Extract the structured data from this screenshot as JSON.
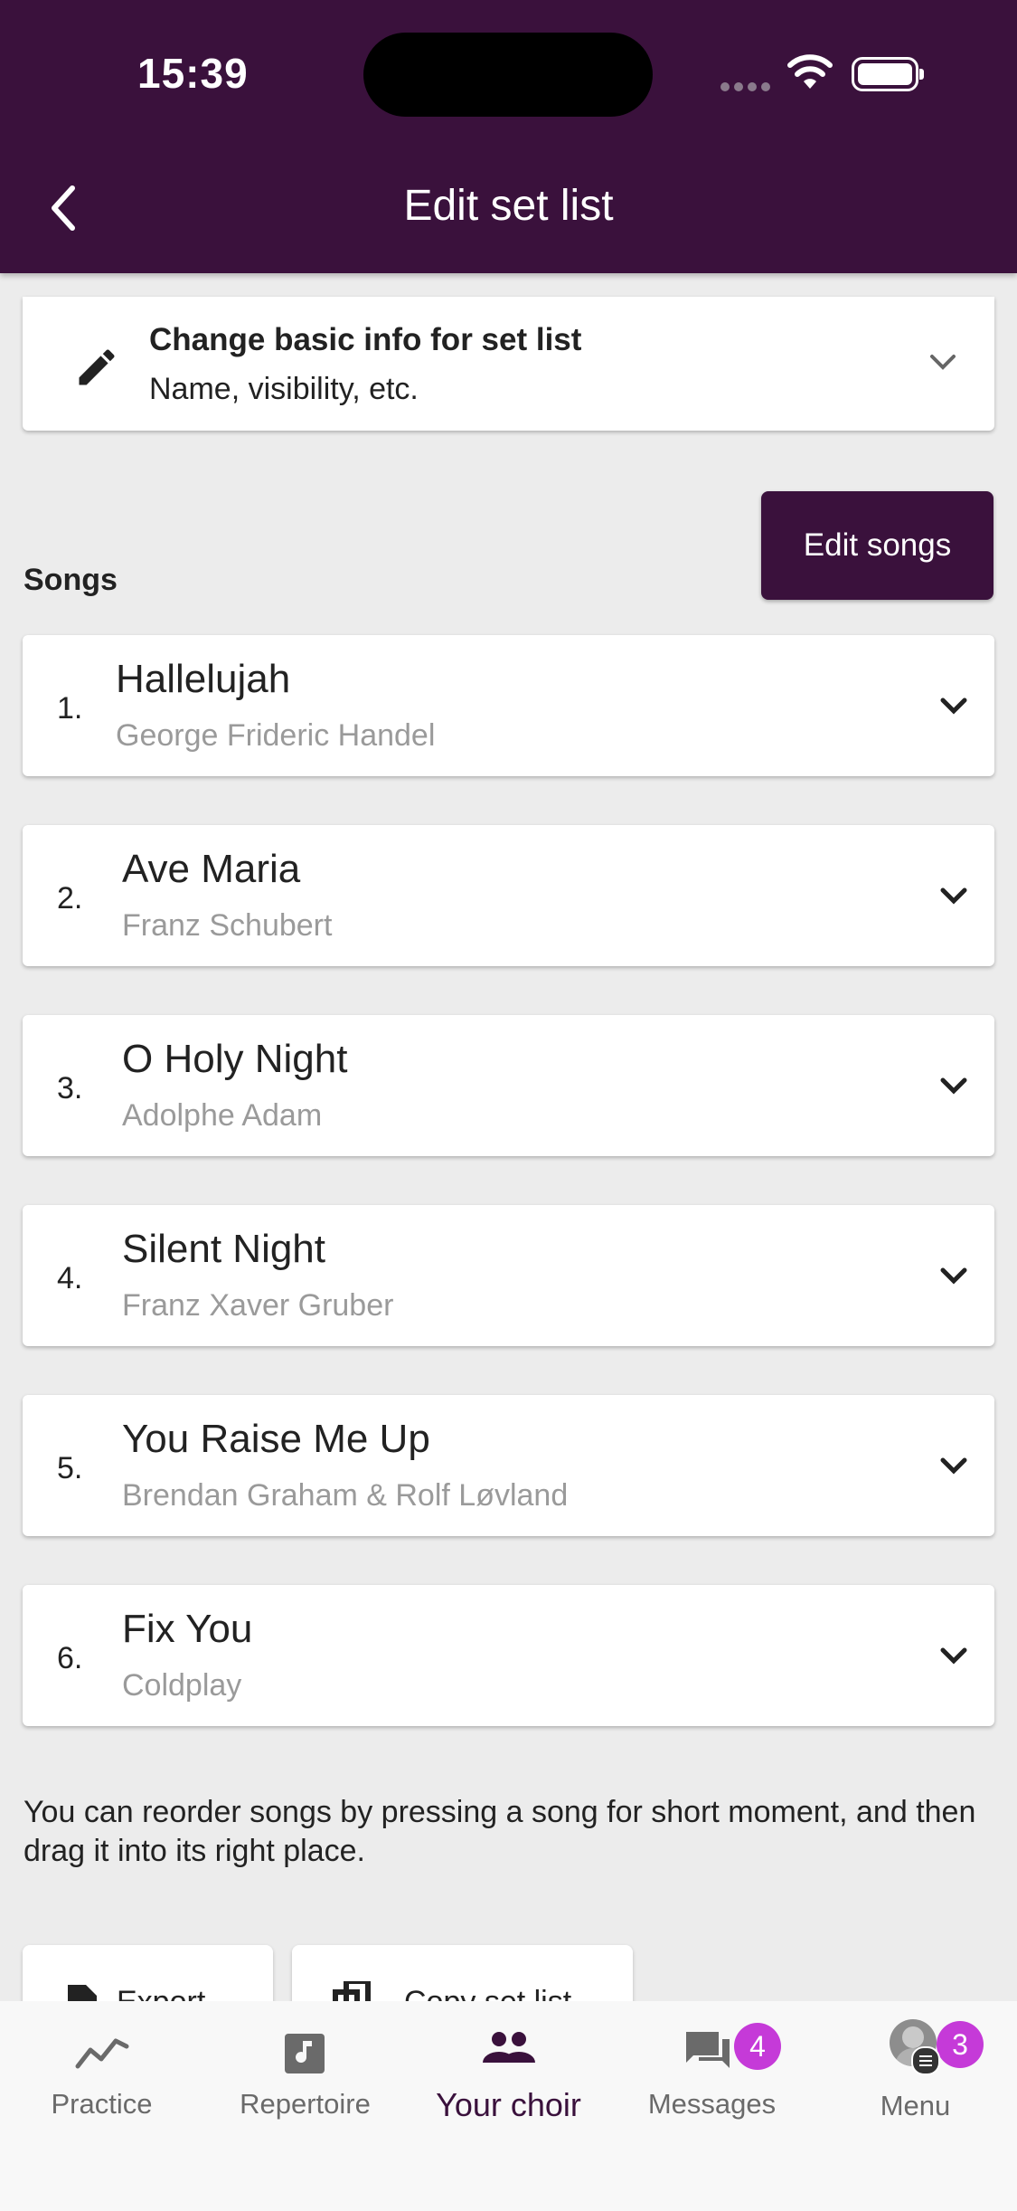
{
  "status_bar": {
    "time": "15:39"
  },
  "header": {
    "title": "Edit set list"
  },
  "info_card": {
    "title": "Change basic info for set list",
    "subtitle": "Name, visibility, etc."
  },
  "edit_songs_button": "Edit songs",
  "songs_heading": "Songs",
  "songs": [
    {
      "num": "1.",
      "title": "Hallelujah",
      "composer": "George Frideric Handel"
    },
    {
      "num": "2.",
      "title": "Ave Maria",
      "composer": "Franz Schubert"
    },
    {
      "num": "3.",
      "title": "O Holy Night",
      "composer": "Adolphe Adam"
    },
    {
      "num": "4.",
      "title": "Silent Night",
      "composer": "Franz Xaver Gruber"
    },
    {
      "num": "5.",
      "title": "You Raise Me Up",
      "composer": "Brendan Graham & Rolf Løvland"
    },
    {
      "num": "6.",
      "title": "Fix You",
      "composer": "Coldplay"
    }
  ],
  "hint": "You can reorder songs by pressing a song for short moment, and then drag it into its right place.",
  "actions": {
    "export": "Export",
    "copy": "Copy set list"
  },
  "tabs": [
    {
      "label": "Practice",
      "icon": "trending-up-icon"
    },
    {
      "label": "Repertoire",
      "icon": "music-library-icon"
    },
    {
      "label": "Your choir",
      "icon": "people-icon",
      "active": true
    },
    {
      "label": "Messages",
      "icon": "chat-icon",
      "badge": "4"
    },
    {
      "label": "Menu",
      "icon": "avatar",
      "badge": "3"
    }
  ],
  "colors": {
    "primary": "#3a113c",
    "badge": "#c53ad8",
    "background": "#ececec"
  }
}
